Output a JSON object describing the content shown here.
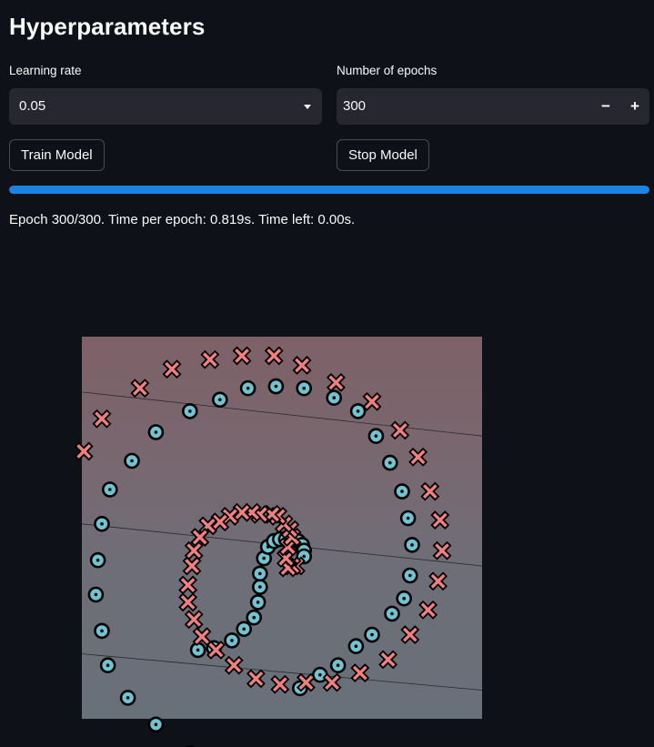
{
  "header": {
    "title": "Hyperparameters"
  },
  "learning_rate": {
    "label": "Learning rate",
    "value": "0.05"
  },
  "epochs": {
    "label": "Number of epochs",
    "value": "300",
    "decrement": "−",
    "increment": "+"
  },
  "buttons": {
    "train": "Train Model",
    "stop": "Stop Model"
  },
  "progress": {
    "value": 1.0,
    "color": "#1c83e1"
  },
  "status": {
    "text": "Epoch 300/300. Time per epoch: 0.819s. Time left: 0.00s."
  },
  "chart_data": {
    "type": "scatter",
    "title": "",
    "xlabel": "",
    "ylabel": "",
    "grid": false,
    "legend": "none",
    "xlim": [
      -1.0,
      1.0
    ],
    "ylim": [
      -1.0,
      1.0
    ],
    "decision_lines": [
      [
        [
          -1.0,
          0.02
        ],
        [
          1.0,
          -0.2
        ]
      ],
      [
        [
          -1.0,
          0.71
        ],
        [
          1.0,
          0.48
        ]
      ],
      [
        [
          -1.0,
          -0.66
        ],
        [
          1.0,
          -0.85
        ]
      ]
    ],
    "series": [
      {
        "marker": "circle",
        "color": "#72c3d2",
        "points": [
          [
            -0.42,
            -0.64
          ],
          [
            -0.34,
            -0.63
          ],
          [
            -0.25,
            -0.59
          ],
          [
            -0.19,
            -0.53
          ],
          [
            -0.14,
            -0.47
          ],
          [
            -0.12,
            -0.39
          ],
          [
            -0.11,
            -0.31
          ],
          [
            -0.11,
            -0.24
          ],
          [
            -0.09,
            -0.16
          ],
          [
            -0.07,
            -0.1
          ],
          [
            -0.04,
            -0.07
          ],
          [
            -0.01,
            -0.06
          ],
          [
            0.02,
            -0.06
          ],
          [
            0.05,
            -0.06
          ],
          [
            0.08,
            -0.07
          ],
          [
            0.1,
            -0.09
          ],
          [
            0.11,
            -0.12
          ],
          [
            0.11,
            -0.15
          ],
          [
            0.09,
            -0.84
          ],
          [
            0.19,
            -0.77
          ],
          [
            0.28,
            -0.72
          ],
          [
            0.37,
            -0.62
          ],
          [
            0.45,
            -0.56
          ],
          [
            0.55,
            -0.45
          ],
          [
            0.61,
            -0.37
          ],
          [
            0.64,
            -0.25
          ],
          [
            0.65,
            -0.09
          ],
          [
            0.63,
            0.05
          ],
          [
            0.6,
            0.19
          ],
          [
            0.54,
            0.34
          ],
          [
            0.47,
            0.48
          ],
          [
            0.38,
            0.61
          ],
          [
            0.26,
            0.68
          ],
          [
            0.11,
            0.73
          ],
          [
            -0.03,
            0.74
          ],
          [
            -0.17,
            0.73
          ],
          [
            -0.31,
            0.67
          ],
          [
            -0.46,
            0.61
          ],
          [
            -0.63,
            0.5
          ],
          [
            -0.75,
            0.35
          ],
          [
            -0.86,
            0.2
          ],
          [
            -0.9,
            0.02
          ],
          [
            -0.92,
            -0.17
          ],
          [
            -0.93,
            -0.35
          ],
          [
            -0.9,
            -0.54
          ],
          [
            -0.87,
            -0.72
          ],
          [
            -0.77,
            -0.89
          ],
          [
            -0.63,
            -1.03
          ],
          [
            -0.46,
            -1.18
          ]
        ]
      },
      {
        "marker": "x",
        "color": "#f08080",
        "points": [
          [
            0.07,
            -0.2
          ],
          [
            0.05,
            -0.2
          ],
          [
            0.03,
            -0.21
          ],
          [
            0.02,
            -0.16
          ],
          [
            0.03,
            -0.1
          ],
          [
            0.05,
            -0.05
          ],
          [
            0.04,
            -0.01
          ],
          [
            0.01,
            0.02
          ],
          [
            -0.02,
            0.06
          ],
          [
            -0.05,
            0.07
          ],
          [
            -0.11,
            0.07
          ],
          [
            -0.15,
            0.08
          ],
          [
            -0.2,
            0.08
          ],
          [
            -0.26,
            0.06
          ],
          [
            -0.31,
            0.03
          ],
          [
            -0.37,
            0.01
          ],
          [
            -0.41,
            -0.05
          ],
          [
            -0.44,
            -0.12
          ],
          [
            -0.45,
            -0.2
          ],
          [
            -0.47,
            -0.3
          ],
          [
            -0.47,
            -0.39
          ],
          [
            -0.44,
            -0.48
          ],
          [
            -0.4,
            -0.57
          ],
          [
            -0.33,
            -0.64
          ],
          [
            -0.24,
            -0.72
          ],
          [
            -0.13,
            -0.79
          ],
          [
            -0.01,
            -0.82
          ],
          [
            0.12,
            -0.81
          ],
          [
            0.25,
            -0.81
          ],
          [
            0.39,
            -0.76
          ],
          [
            0.53,
            -0.69
          ],
          [
            0.64,
            -0.56
          ],
          [
            0.73,
            -0.43
          ],
          [
            0.78,
            -0.28
          ],
          [
            0.8,
            -0.12
          ],
          [
            0.79,
            0.04
          ],
          [
            0.74,
            0.19
          ],
          [
            0.68,
            0.37
          ],
          [
            0.59,
            0.51
          ],
          [
            0.45,
            0.66
          ],
          [
            0.27,
            0.76
          ],
          [
            0.1,
            0.85
          ],
          [
            -0.04,
            0.9
          ],
          [
            -0.2,
            0.9
          ],
          [
            -0.36,
            0.88
          ],
          [
            -0.55,
            0.83
          ],
          [
            -0.71,
            0.73
          ],
          [
            -0.9,
            0.57
          ],
          [
            -0.99,
            0.4
          ]
        ]
      }
    ]
  }
}
